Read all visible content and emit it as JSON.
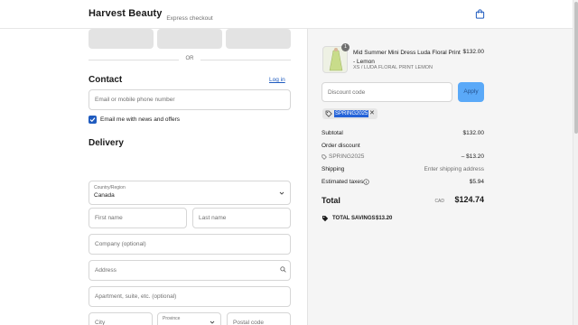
{
  "header": {
    "brand": "Harvest Beauty",
    "cart_icon": "shopping-bag-icon"
  },
  "express": {
    "title": "Express checkout",
    "or": "OR"
  },
  "contact": {
    "title": "Contact",
    "login_link": "Log in",
    "email_placeholder": "Email or mobile phone number",
    "newsletter_label": "Email me with news and offers",
    "newsletter_checked": true
  },
  "delivery": {
    "title": "Delivery",
    "country_label": "Country/Region",
    "country_value": "Canada",
    "first_name": "First name",
    "last_name": "Last name",
    "company": "Company (optional)",
    "address": "Address",
    "apartment": "Apartment, suite, etc. (optional)",
    "city": "City",
    "province": "Province",
    "postal": "Postal code"
  },
  "order": {
    "item": {
      "quantity": "1",
      "name": "Mid Summer Mini Dress Luda Floral Print - Lemon",
      "variant": "XS / LUDA FLORAL PRINT LEMON",
      "price": "$132.00"
    },
    "discount_placeholder": "Discount code",
    "apply_label": "Apply",
    "applied_code": "SPRING2025",
    "summary": {
      "subtotal_label": "Subtotal",
      "subtotal_value": "$132.00",
      "order_discount_label": "Order discount",
      "discount_code": "SPRING2025",
      "discount_value": "– $13.20",
      "shipping_label": "Shipping",
      "shipping_value": "Enter shipping address",
      "taxes_label": "Estimated taxes",
      "taxes_value": "$5.94",
      "total_label": "Total",
      "currency": "CAD",
      "total_value": "$124.74",
      "savings_label": "TOTAL SAVINGS",
      "savings_value": "$13.20"
    }
  },
  "colors": {
    "accent": "#1f5bbf",
    "apply_button": "#5aa9f8",
    "summary_bg": "#f5f5f5"
  }
}
